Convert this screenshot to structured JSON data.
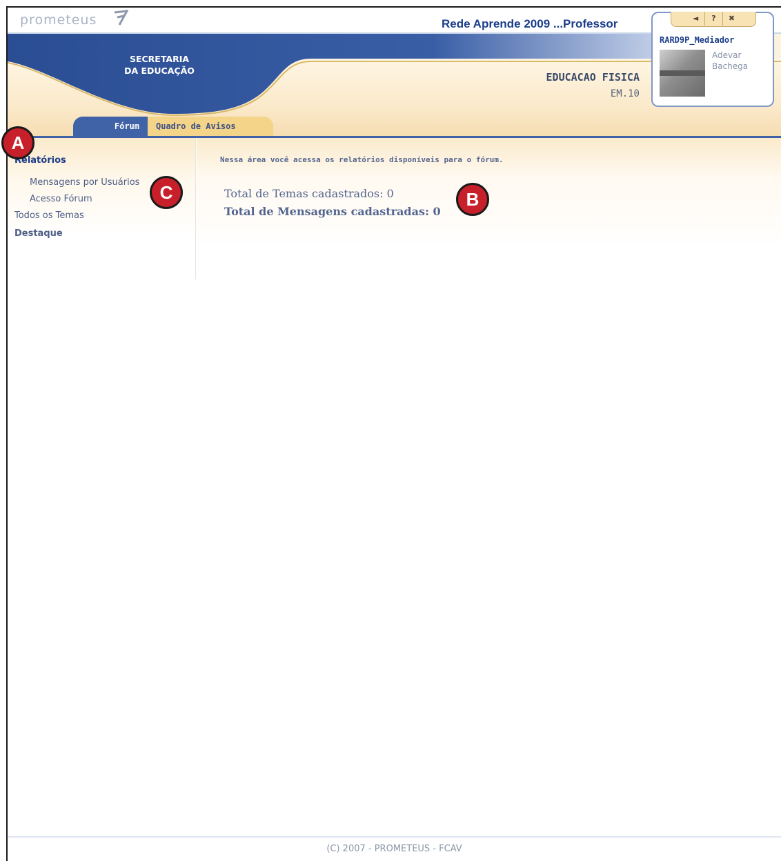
{
  "app": {
    "logo_text": "prometeus",
    "site_title": "Rede Aprende 2009 ...Professor"
  },
  "banner": {
    "org_line1": "SECRETARIA",
    "org_line2": "DA EDUCAÇÃO",
    "course_name": "EDUCACAO FISICA",
    "course_code": "EM.10"
  },
  "user_card": {
    "controls": [
      "◄",
      "?",
      "✖"
    ],
    "username": "RARD9P_Mediador",
    "first_name": "Adevar",
    "last_name": "Bachega"
  },
  "tabs": [
    {
      "label": "Fórum",
      "active": true
    },
    {
      "label": "Quadro de Avisos",
      "active": false
    }
  ],
  "sidebar": {
    "heading": "Relatórios",
    "sub_items": [
      "Mensagens por Usuários",
      "Acesso Fórum"
    ],
    "items": [
      "Todos os Temas",
      "Destaque"
    ]
  },
  "main": {
    "intro": "Nessa área você acessa os relatórios disponíveis para o fórum.",
    "stat_temas": "Total de Temas cadastrados: 0",
    "stat_mensagens": "Total de Mensagens cadastradas: 0"
  },
  "footer": {
    "copyright": "(C) 2007 - PROMETEUS - FCAV"
  },
  "callouts": [
    "A",
    "B",
    "C"
  ],
  "colors": {
    "brand_blue": "#3f63a6",
    "title_blue": "#1b3d8a",
    "tab_gold": "#f3d488",
    "callout_red": "#c8202a"
  }
}
